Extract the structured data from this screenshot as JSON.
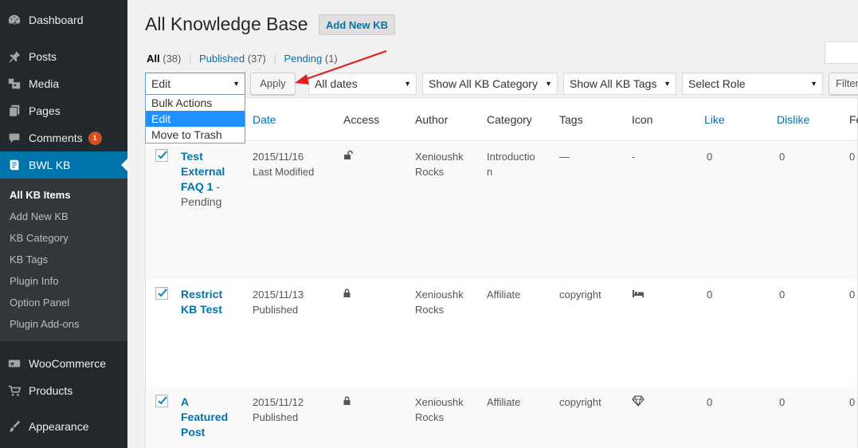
{
  "sidebar": {
    "items": [
      {
        "label": "Dashboard",
        "icon": "dashboard-icon"
      },
      {
        "label": "Posts",
        "icon": "pin-icon"
      },
      {
        "label": "Media",
        "icon": "media-icon"
      },
      {
        "label": "Pages",
        "icon": "pages-icon"
      },
      {
        "label": "Comments",
        "icon": "comment-icon",
        "badge": "1"
      },
      {
        "label": "BWL KB",
        "icon": "book-icon"
      },
      {
        "label": "WooCommerce",
        "icon": "woo-icon"
      },
      {
        "label": "Products",
        "icon": "cart-icon"
      },
      {
        "label": "Appearance",
        "icon": "brush-icon"
      }
    ],
    "submenu": [
      "All KB Items",
      "Add New KB",
      "KB Category",
      "KB Tags",
      "Plugin Info",
      "Option Panel",
      "Plugin Add-ons"
    ]
  },
  "header": {
    "title": "All Knowledge Base",
    "add_new": "Add New KB"
  },
  "filters": {
    "all_label": "All",
    "all_count": "(38)",
    "published_label": "Published",
    "published_count": "(37)",
    "pending_label": "Pending",
    "pending_count": "(1)",
    "sep": "|"
  },
  "toolbar": {
    "bulk_value": "Edit",
    "bulk_options": [
      "Bulk Actions",
      "Edit",
      "Move to Trash"
    ],
    "apply": "Apply",
    "dates": "All dates",
    "category": "Show All KB Category",
    "tags": "Show All KB Tags",
    "role": "Select Role",
    "filter": "Filter"
  },
  "table": {
    "headers": {
      "date": "Date",
      "access": "Access",
      "author": "Author",
      "category": "Category",
      "tags": "Tags",
      "icon": "Icon",
      "like": "Like",
      "dislike": "Dislike",
      "fe": "Fe"
    },
    "rows": [
      {
        "title_lines": [
          "Test",
          "External",
          "FAQ 1"
        ],
        "title_suffix": " -",
        "state": "Pending",
        "date": "2015/11/16",
        "status": "Last Modified",
        "access": "unlock-icon",
        "author_lines": [
          "Xenioushk",
          "Rocks"
        ],
        "category_lines": [
          "Introductio",
          "n"
        ],
        "tags": "—",
        "icon_text": "-",
        "like": "0",
        "dislike": "0",
        "fe": "0"
      },
      {
        "title_lines": [
          "Restrict",
          "KB Test"
        ],
        "state": "",
        "date": "2015/11/13",
        "status": "Published",
        "access": "lock-icon",
        "author_lines": [
          "Xenioushk",
          "Rocks"
        ],
        "category_lines": [
          "Affiliate"
        ],
        "tags": "copyright",
        "icon_text": "bed-icon",
        "like": "0",
        "dislike": "0",
        "fe": "0"
      },
      {
        "title_lines": [
          "A",
          "Featured",
          "Post"
        ],
        "state": "",
        "date": "2015/11/12",
        "status": "Published",
        "access": "lock-icon",
        "author_lines": [
          "Xenioushk",
          "Rocks"
        ],
        "category_lines": [
          "Affiliate"
        ],
        "tags": "copyright",
        "icon_text": "diamond-icon",
        "like": "0",
        "dislike": "0",
        "fe": "0"
      }
    ]
  },
  "colors": {
    "sidebar_bg": "#23282d",
    "active_bg": "#0073aa",
    "link": "#0073aa",
    "badge": "#d54e21",
    "annotation_arrow": "#e02020"
  }
}
